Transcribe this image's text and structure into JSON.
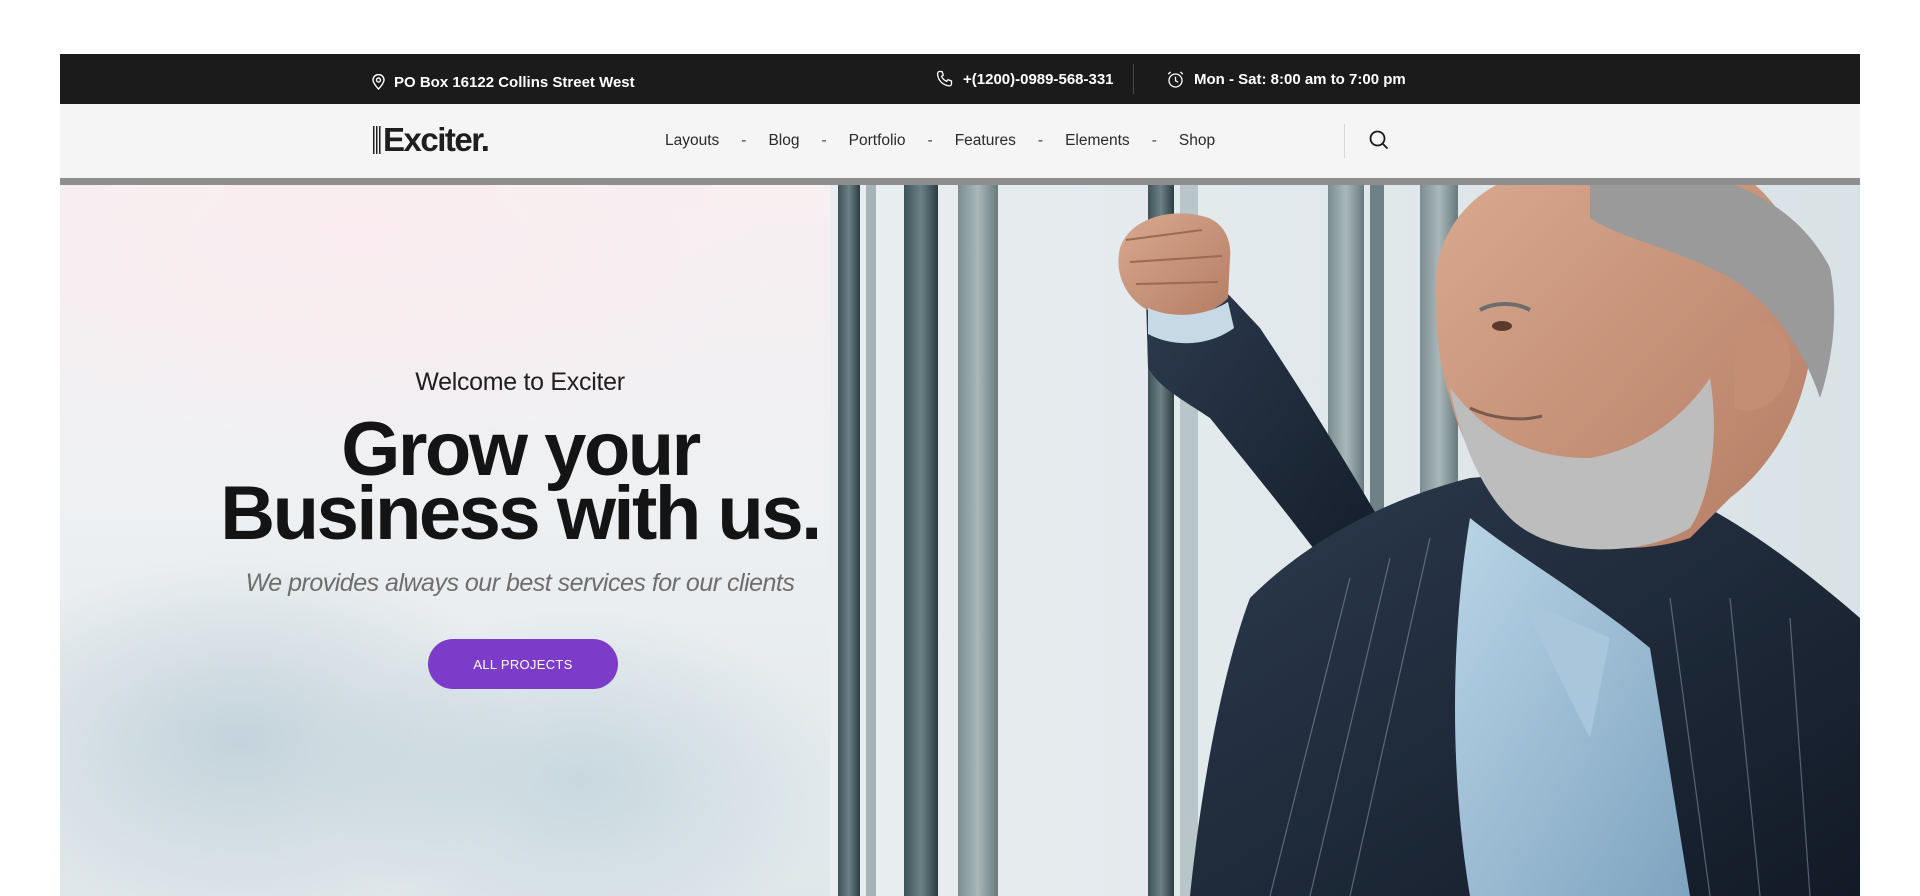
{
  "topbar": {
    "address": "PO Box 16122 Collins Street West",
    "phone": "+(1200)-0989-568-331",
    "hours": "Mon - Sat: 8:00 am to 7:00 pm",
    "address_icon": "map-pin-icon",
    "phone_icon": "phone-icon",
    "hours_icon": "alarm-clock-icon"
  },
  "brand": {
    "logo_text": "Exciter."
  },
  "nav": {
    "items": [
      "Layouts",
      "Blog",
      "Portfolio",
      "Features",
      "Elements",
      "Shop"
    ],
    "separator": "-",
    "search_icon": "search-icon"
  },
  "hero": {
    "welcome": "Welcome to Exciter",
    "headline_line1": "Grow your",
    "headline_line2": "Business with us.",
    "subtitle": "We provides always our best services for our clients",
    "cta_label": "ALL PROJECTS"
  },
  "colors": {
    "topbar_bg": "#1b1b1b",
    "navbar_bg": "#f5f5f5",
    "accent": "#7d3bc9",
    "headline": "#141414"
  }
}
